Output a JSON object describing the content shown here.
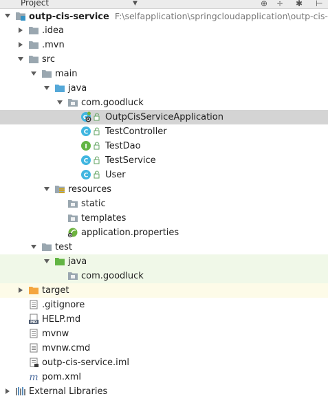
{
  "toolbar": {
    "title": "Project"
  },
  "root": {
    "name": "outp-cis-service",
    "path": "F:\\selfapplication\\springcloudapplication\\outp-cis-service"
  },
  "tree": [
    {
      "label": "outp-cis-service",
      "kind": "module",
      "expanded": true,
      "depth": 0
    },
    {
      "label": ".idea",
      "kind": "folder",
      "expanded": false,
      "depth": 1
    },
    {
      "label": ".mvn",
      "kind": "folder",
      "expanded": false,
      "depth": 1
    },
    {
      "label": "src",
      "kind": "folder",
      "expanded": true,
      "depth": 1
    },
    {
      "label": "main",
      "kind": "folder",
      "expanded": true,
      "depth": 2
    },
    {
      "label": "java",
      "kind": "source-folder",
      "expanded": true,
      "depth": 3
    },
    {
      "label": "com.goodluck",
      "kind": "package",
      "expanded": true,
      "depth": 4
    },
    {
      "label": "OutpCisServiceApplication",
      "kind": "spring-class",
      "depth": 5,
      "selected": true
    },
    {
      "label": "TestController",
      "kind": "class",
      "depth": 5
    },
    {
      "label": "TestDao",
      "kind": "interface",
      "depth": 5
    },
    {
      "label": "TestService",
      "kind": "class",
      "depth": 5
    },
    {
      "label": "User",
      "kind": "class",
      "depth": 5
    },
    {
      "label": "resources",
      "kind": "resources-folder",
      "expanded": true,
      "depth": 3
    },
    {
      "label": "static",
      "kind": "package",
      "depth": 4
    },
    {
      "label": "templates",
      "kind": "package",
      "depth": 4
    },
    {
      "label": "application.properties",
      "kind": "spring-properties",
      "depth": 4
    },
    {
      "label": "test",
      "kind": "folder",
      "expanded": true,
      "depth": 2
    },
    {
      "label": "java",
      "kind": "test-folder",
      "expanded": true,
      "depth": 3
    },
    {
      "label": "com.goodluck",
      "kind": "package",
      "depth": 4
    },
    {
      "label": "target",
      "kind": "excluded-folder",
      "expanded": false,
      "depth": 1
    },
    {
      "label": ".gitignore",
      "kind": "file",
      "depth": 1
    },
    {
      "label": "HELP.md",
      "kind": "md-file",
      "depth": 1
    },
    {
      "label": "mvnw",
      "kind": "file",
      "depth": 1
    },
    {
      "label": "mvnw.cmd",
      "kind": "file",
      "depth": 1
    },
    {
      "label": "outp-cis-service.iml",
      "kind": "iml-file",
      "depth": 1
    },
    {
      "label": "pom.xml",
      "kind": "maven-file",
      "depth": 1
    },
    {
      "label": "External Libraries",
      "kind": "libraries",
      "expanded": false,
      "depth": 0
    }
  ],
  "colors": {
    "selection": "#d4d4d4",
    "test_background": "#f0f8e8",
    "excluded_background": "#fdfbe8",
    "folder": "#9aa7b0",
    "source_folder": "#55a8d8",
    "test_folder": "#62b543",
    "excluded_folder": "#f4a640",
    "class_icon": "#40b6e0",
    "interface_icon": "#62b543",
    "spring": "#6db33f"
  }
}
